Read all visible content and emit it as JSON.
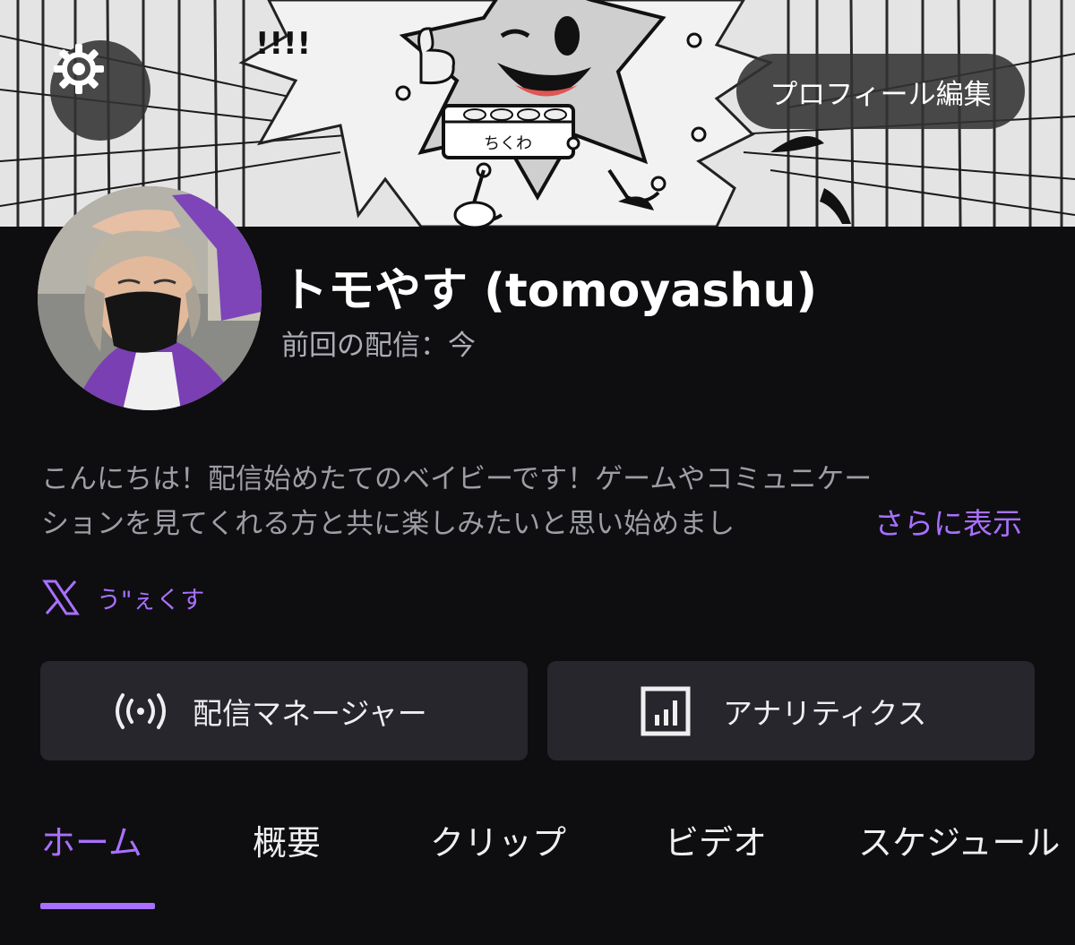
{
  "header": {
    "settings_icon": "gear-icon",
    "edit_profile_label": "プロフィール編集"
  },
  "profile": {
    "display_name": "トモやす (tomoyashu)",
    "last_stream": "前回の配信：今",
    "bio_line1": "こんにちは！配信始めたてのベイビーです！ゲームやコミュニケー",
    "bio_line2": "ションを見てくれる方と共に楽しみたいと思い始めまし",
    "more_label": "さらに表示"
  },
  "banner_art": {
    "box_text": "ちくわ",
    "exclaim_text": "!!!!"
  },
  "social": {
    "icon": "x-logo-icon",
    "label": "う\"ぇくす"
  },
  "actions": {
    "stream_manager_label": "配信マネージャー",
    "stream_manager_icon": "broadcast-icon",
    "analytics_label": "アナリティクス",
    "analytics_icon": "bar-chart-icon"
  },
  "tabs": [
    {
      "label": "ホーム",
      "active": true
    },
    {
      "label": "概要",
      "active": false
    },
    {
      "label": "クリップ",
      "active": false
    },
    {
      "label": "ビデオ",
      "active": false
    },
    {
      "label": "スケジュール",
      "active": false
    }
  ],
  "colors": {
    "background": "#0e0e10",
    "accent": "#a970ff",
    "button_bg": "#26262c",
    "muted_text": "#9d9da6"
  }
}
